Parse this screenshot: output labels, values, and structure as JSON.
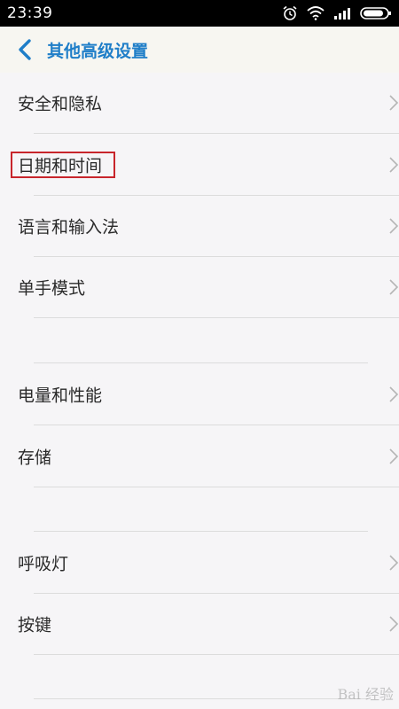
{
  "status_bar": {
    "time": "23:39",
    "icons": [
      "alarm-icon",
      "wifi-icon",
      "signal-icon",
      "battery-icon"
    ]
  },
  "header": {
    "title": "其他高级设置",
    "back_icon": "chevron-left-icon",
    "accent_color": "#1f7ec8"
  },
  "items": [
    {
      "label": "安全和隐私",
      "action": "chevron-right-icon"
    },
    {
      "label": "日期和时间",
      "action": "chevron-right-icon",
      "highlighted": true
    },
    {
      "label": "语言和输入法",
      "action": "chevron-right-icon"
    },
    {
      "label": "单手模式",
      "action": "chevron-right-icon"
    },
    {
      "label": "电量和性能",
      "action": "chevron-right-icon"
    },
    {
      "label": "存储",
      "action": "chevron-right-icon"
    },
    {
      "label": "呼吸灯",
      "action": "chevron-right-icon"
    },
    {
      "label": "按键",
      "action": "chevron-right-icon"
    }
  ],
  "annotation": {
    "highlight_color": "#c8252b"
  },
  "watermark": {
    "text": "Bai 经验"
  }
}
